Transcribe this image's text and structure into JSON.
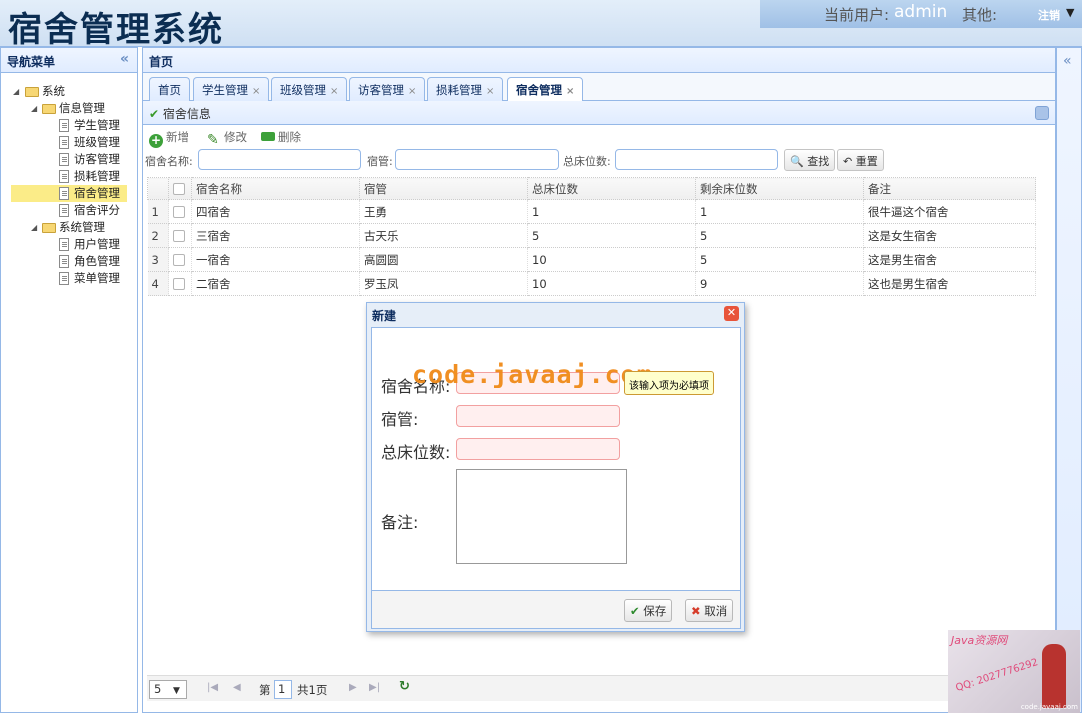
{
  "header": {
    "app_title": "宿舍管理系统",
    "current_user_label": "当前用户:",
    "username": "admin",
    "other_label": "其他:",
    "logout": "注销"
  },
  "nav": {
    "title": "导航菜单",
    "tree": [
      {
        "label": "系统",
        "type": "folder",
        "level": 0
      },
      {
        "label": "信息管理",
        "type": "folder",
        "level": 1
      },
      {
        "label": "学生管理",
        "type": "file",
        "level": 2
      },
      {
        "label": "班级管理",
        "type": "file",
        "level": 2
      },
      {
        "label": "访客管理",
        "type": "file",
        "level": 2
      },
      {
        "label": "损耗管理",
        "type": "file",
        "level": 2
      },
      {
        "label": "宿舍管理",
        "type": "file",
        "level": 2,
        "selected": true
      },
      {
        "label": "宿舍评分",
        "type": "file",
        "level": 2
      },
      {
        "label": "系统管理",
        "type": "folder",
        "level": 1
      },
      {
        "label": "用户管理",
        "type": "file",
        "level": 2
      },
      {
        "label": "角色管理",
        "type": "file",
        "level": 2
      },
      {
        "label": "菜单管理",
        "type": "file",
        "level": 2
      }
    ]
  },
  "main": {
    "title": "首页",
    "tabs": [
      {
        "label": "首页",
        "closable": false
      },
      {
        "label": "学生管理",
        "closable": true
      },
      {
        "label": "班级管理",
        "closable": true
      },
      {
        "label": "访客管理",
        "closable": true
      },
      {
        "label": "损耗管理",
        "closable": true
      },
      {
        "label": "宿舍管理",
        "closable": true,
        "active": true
      }
    ],
    "panel_title": "宿舍信息",
    "toolbar": {
      "add": "新增",
      "edit": "修改",
      "delete": "删除"
    },
    "search": {
      "name_label": "宿舍名称:",
      "manager_label": "宿管:",
      "beds_label": "总床位数:",
      "find": "查找",
      "reset": "重置"
    },
    "table": {
      "columns": [
        "宿舍名称",
        "宿管",
        "总床位数",
        "剩余床位数",
        "备注"
      ],
      "rows": [
        {
          "n": "1",
          "name": "四宿舍",
          "manager": "王勇",
          "total": "1",
          "left": "1",
          "note": "很牛逼这个宿舍"
        },
        {
          "n": "2",
          "name": "三宿舍",
          "manager": "古天乐",
          "total": "5",
          "left": "5",
          "note": "这是女生宿舍"
        },
        {
          "n": "3",
          "name": "一宿舍",
          "manager": "高圆圆",
          "total": "10",
          "left": "5",
          "note": "这是男生宿舍"
        },
        {
          "n": "4",
          "name": "二宿舍",
          "manager": "罗玉凤",
          "total": "10",
          "left": "9",
          "note": "这也是男生宿舍"
        }
      ]
    },
    "pager": {
      "page_size": "5",
      "page_prefix": "第",
      "page": "1",
      "total": "共1页"
    }
  },
  "dialog": {
    "title": "新建",
    "name_label": "宿舍名称:",
    "manager_label": "宿管:",
    "beds_label": "总床位数:",
    "note_label": "备注:",
    "tooltip": "该输入项为必填项",
    "watermark": "code.javaaj.com",
    "save": "保存",
    "cancel": "取消"
  },
  "corner_ad": {
    "title": "Java资源网",
    "qq": "QQ: 2027776292",
    "site": "code.javaaj.com"
  }
}
